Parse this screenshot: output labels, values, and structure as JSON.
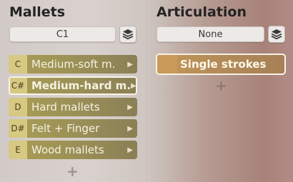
{
  "mallets": {
    "title": "Mallets",
    "selector_value": "C1",
    "items": [
      {
        "key": "C",
        "label": "Medium-soft m."
      },
      {
        "key": "C#",
        "label": "Medium-hard m."
      },
      {
        "key": "D",
        "label": "Hard mallets"
      },
      {
        "key": "D#",
        "label": "Felt + Finger"
      },
      {
        "key": "E",
        "label": "Wood mallets"
      }
    ],
    "selected_index": 1,
    "add_symbol": "+"
  },
  "articulation": {
    "title": "Articulation",
    "selector_value": "None",
    "items": [
      {
        "label": "Single strokes"
      }
    ],
    "add_symbol": "+"
  },
  "icons": {
    "stack": "layers-icon",
    "arrow": "chevron-right-icon",
    "add": "plus-icon"
  },
  "colors": {
    "mallet_item": "#9a8f57",
    "mallet_key": "#d7c882",
    "articulation_item": "#b58c58"
  }
}
